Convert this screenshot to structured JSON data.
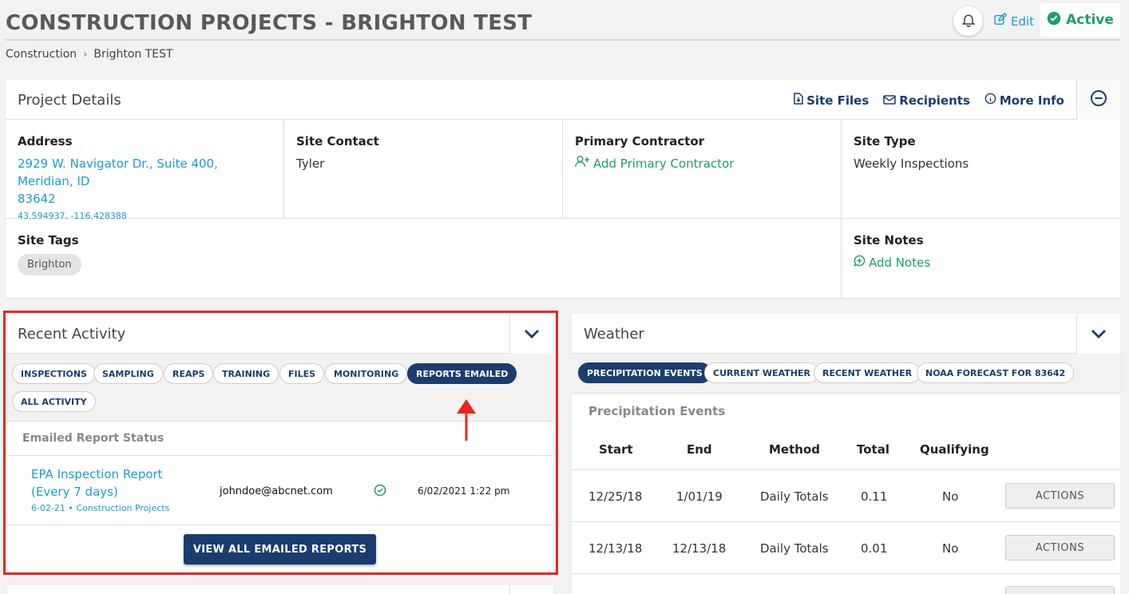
{
  "header": {
    "title": "CONSTRUCTION PROJECTS - BRIGHTON TEST",
    "edit_label": "Edit",
    "status_label": "Active"
  },
  "breadcrumb": {
    "items": [
      "Construction",
      "Brighton TEST"
    ],
    "separator": "›"
  },
  "project_details": {
    "title": "Project Details",
    "links": {
      "site_files": "Site Files",
      "recipients": "Recipients",
      "more_info": "More Info"
    },
    "address": {
      "label": "Address",
      "line1": "2929 W. Navigator Dr., Suite 400, Meridian, ID",
      "line2": "83642",
      "coords": "43.594937, -116.428388"
    },
    "site_contact": {
      "label": "Site Contact",
      "value": "Tyler"
    },
    "primary_contractor": {
      "label": "Primary Contractor",
      "action": "Add Primary Contractor"
    },
    "site_type": {
      "label": "Site Type",
      "value": "Weekly Inspections"
    },
    "site_tags": {
      "label": "Site Tags",
      "tags": [
        "Brighton"
      ]
    },
    "site_notes": {
      "label": "Site Notes",
      "action": "Add Notes"
    }
  },
  "recent_activity": {
    "title": "Recent Activity",
    "filters": [
      "INSPECTIONS",
      "SAMPLING",
      "REAPS",
      "TRAINING",
      "FILES",
      "MONITORING",
      "REPORTS EMAILED",
      "ALL ACTIVITY"
    ],
    "active_filter": "REPORTS EMAILED",
    "section_label": "Emailed Report Status",
    "report": {
      "title_line1": "EPA Inspection Report",
      "title_line2": "(Every 7 days)",
      "meta": "6-02-21 • Construction Projects",
      "email": "johndoe@abcnet.com",
      "date": "6/02/2021 1:22 pm"
    },
    "view_all_label": "VIEW ALL EMAILED REPORTS"
  },
  "weather": {
    "title": "Weather",
    "tabs": [
      "PRECIPITATION EVENTS",
      "CURRENT WEATHER",
      "RECENT WEATHER",
      "NOAA FORECAST FOR 83642"
    ],
    "active_tab": "PRECIPITATION EVENTS",
    "section_label": "Precipitation Events",
    "columns": [
      "Start",
      "End",
      "Method",
      "Total",
      "Qualifying"
    ],
    "rows": [
      {
        "start": "12/25/18",
        "end": "1/01/19",
        "method": "Daily Totals",
        "total": "0.11",
        "qualifying": "No",
        "action": "ACTIONS"
      },
      {
        "start": "12/13/18",
        "end": "12/13/18",
        "method": "Daily Totals",
        "total": "0.01",
        "qualifying": "No",
        "action": "ACTIONS"
      }
    ]
  },
  "colors": {
    "navy": "#1b3d6e",
    "link_blue": "#1a9bd7",
    "green": "#1e9e6a",
    "highlight_red": "#e8261d"
  }
}
